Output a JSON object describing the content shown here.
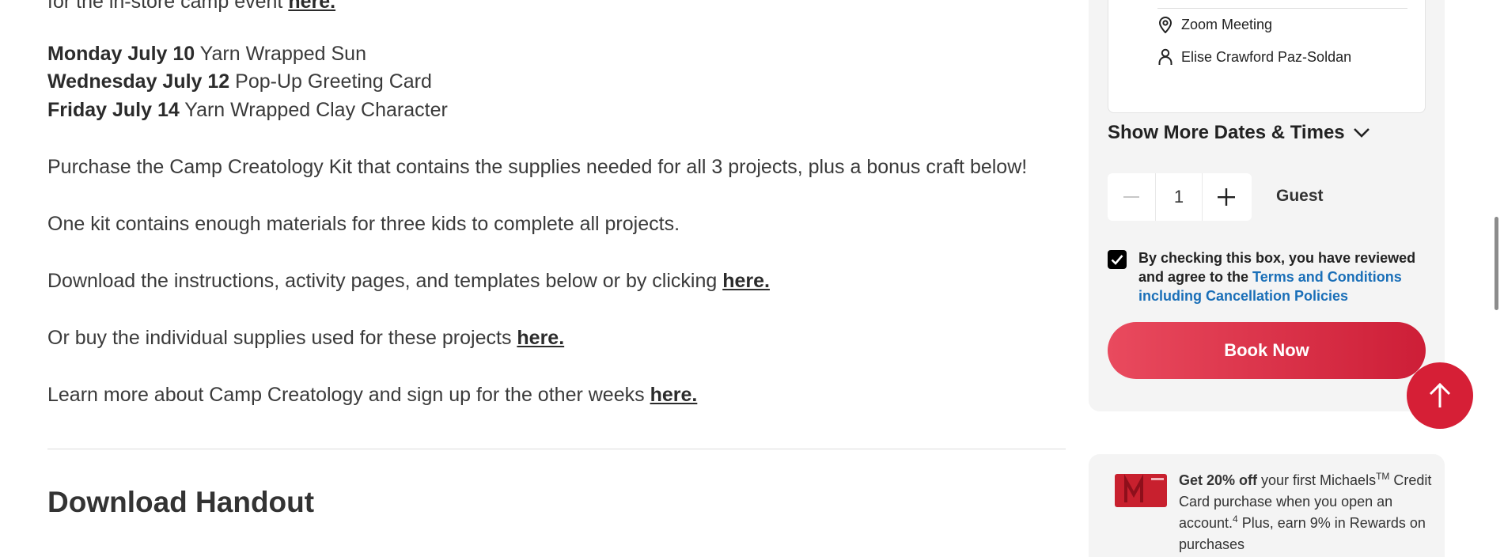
{
  "content": {
    "top_partial": {
      "text": "for the in-store camp event ",
      "link": "here."
    },
    "schedule": [
      {
        "day": "Monday July 10",
        "project": " Yarn Wrapped Sun"
      },
      {
        "day": "Wednesday July 12",
        "project": " Pop-Up Greeting Card"
      },
      {
        "day": "Friday July 14",
        "project": " Yarn Wrapped Clay Character"
      }
    ],
    "purchase_text": "Purchase the Camp Creatology Kit that contains the supplies needed for all 3 projects, plus a bonus craft below!",
    "kit_text": "One kit contains enough materials for three kids to complete all projects.",
    "download": {
      "text": "Download the instructions, activity pages, and templates below or by clicking ",
      "link": "here."
    },
    "buy": {
      "text": "Or buy the individual supplies used for these projects ",
      "link": "here."
    },
    "learn": {
      "text": "Learn more about Camp Creatology and sign up for the other weeks ",
      "link": "here."
    },
    "handout_heading": "Download Handout"
  },
  "sidebar": {
    "location": "Zoom Meeting",
    "instructor": "Elise Crawford Paz-Soldan",
    "show_more": "Show More Dates & Times",
    "quantity": "1",
    "guest_label": "Guest",
    "terms_text": "By checking this box, you have reviewed and agree to the ",
    "terms_link": "Terms and Conditions including Cancellation Policies",
    "book_label": "Book Now",
    "accent": "#d61f36",
    "link_color": "#1a6fb8"
  },
  "promo": {
    "bold": "Get 20% off",
    "text1": " your first Michaels",
    "tm": "TM",
    "text2": " Credit Card purchase when you open an account.",
    "note": "4",
    "text3": " Plus, earn 9% in Rewards on purchases"
  }
}
